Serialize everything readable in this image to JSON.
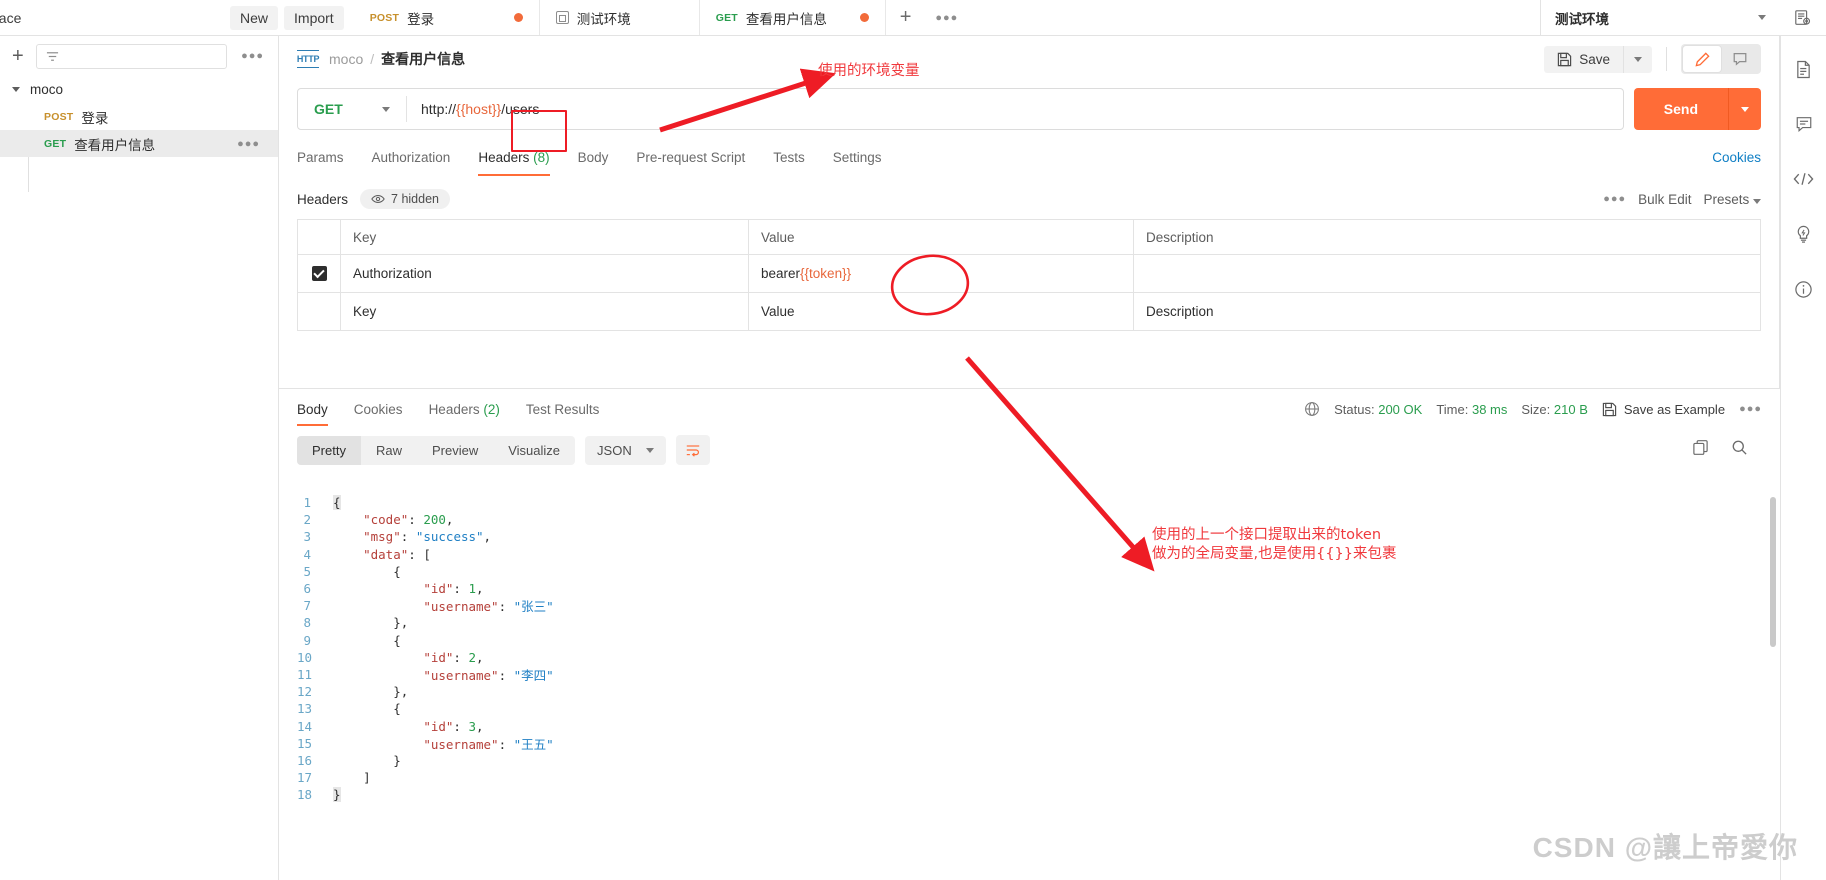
{
  "topbar": {
    "workspace_label": "space",
    "new_button": "New",
    "import_button": "Import",
    "tabs": [
      {
        "method": "POST",
        "title": "登录",
        "unsaved": true,
        "kind": "request"
      },
      {
        "method": "",
        "title": "测试环境",
        "unsaved": false,
        "kind": "environment"
      },
      {
        "method": "GET",
        "title": "查看用户信息",
        "unsaved": true,
        "kind": "request"
      }
    ],
    "add_tab_icon": "plus-icon",
    "tab_overflow_icon": "ellipsis-icon",
    "environment_selected": "测试环境",
    "env_eye_icon": "environment-quick-look-icon"
  },
  "sidebar": {
    "add_icon": "plus-icon",
    "filter_icon": "filter-icon",
    "filter_placeholder": "",
    "more_icon": "ellipsis-icon",
    "collection": {
      "name": "moco",
      "expanded": true
    },
    "requests": [
      {
        "method": "POST",
        "name": "登录",
        "selected": false
      },
      {
        "method": "GET",
        "name": "查看用户信息",
        "selected": true
      }
    ]
  },
  "rightrail": {
    "icons": [
      "documentation-icon",
      "comments-icon",
      "code-icon",
      "mock-bolt-icon",
      "info-icon"
    ]
  },
  "request": {
    "breadcrumb": {
      "protocol_icon": "http-icon",
      "parent": "moco",
      "separator": "/",
      "name": "查看用户信息"
    },
    "save_label": "Save",
    "save_caret_icon": "chevron-down-icon",
    "edit_icon": "pencil-icon",
    "comment_icon": "comment-icon",
    "method": "GET",
    "url_prefix": "http://",
    "url_variable": "{{host}}",
    "url_suffix": "/users",
    "send_label": "Send",
    "tabs": [
      {
        "label": "Params",
        "count": "",
        "active": false
      },
      {
        "label": "Authorization",
        "count": "",
        "active": false
      },
      {
        "label": "Headers",
        "count": "(8)",
        "active": true
      },
      {
        "label": "Body",
        "count": "",
        "active": false
      },
      {
        "label": "Pre-request Script",
        "count": "",
        "active": false
      },
      {
        "label": "Tests",
        "count": "",
        "active": false
      },
      {
        "label": "Settings",
        "count": "",
        "active": false
      }
    ],
    "cookies_link": "Cookies",
    "headers": {
      "section_label": "Headers",
      "hidden_pill": "7 hidden",
      "hidden_icon": "eye-icon",
      "more_icon": "ellipsis-icon",
      "bulk_edit": "Bulk Edit",
      "presets": "Presets",
      "presets_caret_icon": "chevron-down-icon",
      "columns": [
        "Key",
        "Value",
        "Description"
      ],
      "rows": [
        {
          "checked": true,
          "key": "Authorization",
          "value_plain": "bearer ",
          "value_variable": "{{token}}",
          "description": ""
        }
      ],
      "empty_row": {
        "key": "Key",
        "value": "Value",
        "description": "Description"
      }
    }
  },
  "response": {
    "tabs": [
      {
        "label": "Body",
        "count": "",
        "active": true
      },
      {
        "label": "Cookies",
        "count": "",
        "active": false
      },
      {
        "label": "Headers",
        "count": "(2)",
        "active": false
      },
      {
        "label": "Test Results",
        "count": "",
        "active": false
      }
    ],
    "globe_icon": "globe-icon",
    "status_label": "Status:",
    "status_value": "200 OK",
    "time_label": "Time:",
    "time_value": "38 ms",
    "size_label": "Size:",
    "size_value": "210 B",
    "save_example_label": "Save as Example",
    "save_example_icon": "save-icon",
    "more_icon": "ellipsis-icon",
    "view_modes": [
      {
        "label": "Pretty",
        "active": true
      },
      {
        "label": "Raw",
        "active": false
      },
      {
        "label": "Preview",
        "active": false
      },
      {
        "label": "Visualize",
        "active": false
      }
    ],
    "format": "JSON",
    "format_caret_icon": "chevron-down-icon",
    "wrap_icon": "text-wrap-icon",
    "copy_icon": "copy-icon",
    "search_icon": "search-icon",
    "body_lines": [
      {
        "n": "1",
        "indent": 0,
        "tokens": [
          {
            "t": "brace",
            "v": "{"
          }
        ]
      },
      {
        "n": "2",
        "indent": 1,
        "tokens": [
          {
            "t": "key",
            "v": "\"code\""
          },
          {
            "t": "pun",
            "v": ": "
          },
          {
            "t": "num",
            "v": "200"
          },
          {
            "t": "pun",
            "v": ","
          }
        ]
      },
      {
        "n": "3",
        "indent": 1,
        "tokens": [
          {
            "t": "key",
            "v": "\"msg\""
          },
          {
            "t": "pun",
            "v": ": "
          },
          {
            "t": "str",
            "v": "\"success\""
          },
          {
            "t": "pun",
            "v": ","
          }
        ]
      },
      {
        "n": "4",
        "indent": 1,
        "tokens": [
          {
            "t": "key",
            "v": "\"data\""
          },
          {
            "t": "pun",
            "v": ": "
          },
          {
            "t": "pun",
            "v": "["
          }
        ]
      },
      {
        "n": "5",
        "indent": 2,
        "tokens": [
          {
            "t": "pun",
            "v": "{"
          }
        ]
      },
      {
        "n": "6",
        "indent": 3,
        "tokens": [
          {
            "t": "key",
            "v": "\"id\""
          },
          {
            "t": "pun",
            "v": ": "
          },
          {
            "t": "num",
            "v": "1"
          },
          {
            "t": "pun",
            "v": ","
          }
        ]
      },
      {
        "n": "7",
        "indent": 3,
        "tokens": [
          {
            "t": "key",
            "v": "\"username\""
          },
          {
            "t": "pun",
            "v": ": "
          },
          {
            "t": "str",
            "v": "\"张三\""
          }
        ]
      },
      {
        "n": "8",
        "indent": 2,
        "tokens": [
          {
            "t": "pun",
            "v": "},"
          }
        ]
      },
      {
        "n": "9",
        "indent": 2,
        "tokens": [
          {
            "t": "pun",
            "v": "{"
          }
        ]
      },
      {
        "n": "10",
        "indent": 3,
        "tokens": [
          {
            "t": "key",
            "v": "\"id\""
          },
          {
            "t": "pun",
            "v": ": "
          },
          {
            "t": "num",
            "v": "2"
          },
          {
            "t": "pun",
            "v": ","
          }
        ]
      },
      {
        "n": "11",
        "indent": 3,
        "tokens": [
          {
            "t": "key",
            "v": "\"username\""
          },
          {
            "t": "pun",
            "v": ": "
          },
          {
            "t": "str",
            "v": "\"李四\""
          }
        ]
      },
      {
        "n": "12",
        "indent": 2,
        "tokens": [
          {
            "t": "pun",
            "v": "},"
          }
        ]
      },
      {
        "n": "13",
        "indent": 2,
        "tokens": [
          {
            "t": "pun",
            "v": "{"
          }
        ]
      },
      {
        "n": "14",
        "indent": 3,
        "tokens": [
          {
            "t": "key",
            "v": "\"id\""
          },
          {
            "t": "pun",
            "v": ": "
          },
          {
            "t": "num",
            "v": "3"
          },
          {
            "t": "pun",
            "v": ","
          }
        ]
      },
      {
        "n": "15",
        "indent": 3,
        "tokens": [
          {
            "t": "key",
            "v": "\"username\""
          },
          {
            "t": "pun",
            "v": ": "
          },
          {
            "t": "str",
            "v": "\"王五\""
          }
        ]
      },
      {
        "n": "16",
        "indent": 2,
        "tokens": [
          {
            "t": "pun",
            "v": "}"
          }
        ]
      },
      {
        "n": "17",
        "indent": 1,
        "tokens": [
          {
            "t": "pun",
            "v": "]"
          }
        ]
      },
      {
        "n": "18",
        "indent": 0,
        "tokens": [
          {
            "t": "brace",
            "v": "}"
          }
        ]
      }
    ]
  },
  "annotations": {
    "color": "#f0393d",
    "env_var_note": "使用的环境变量",
    "token_note": "使用的上一个接口提取出来的token\n做为的全局变量,也是使用{{}}来包裹"
  },
  "watermark": "CSDN @讓上帝愛你"
}
